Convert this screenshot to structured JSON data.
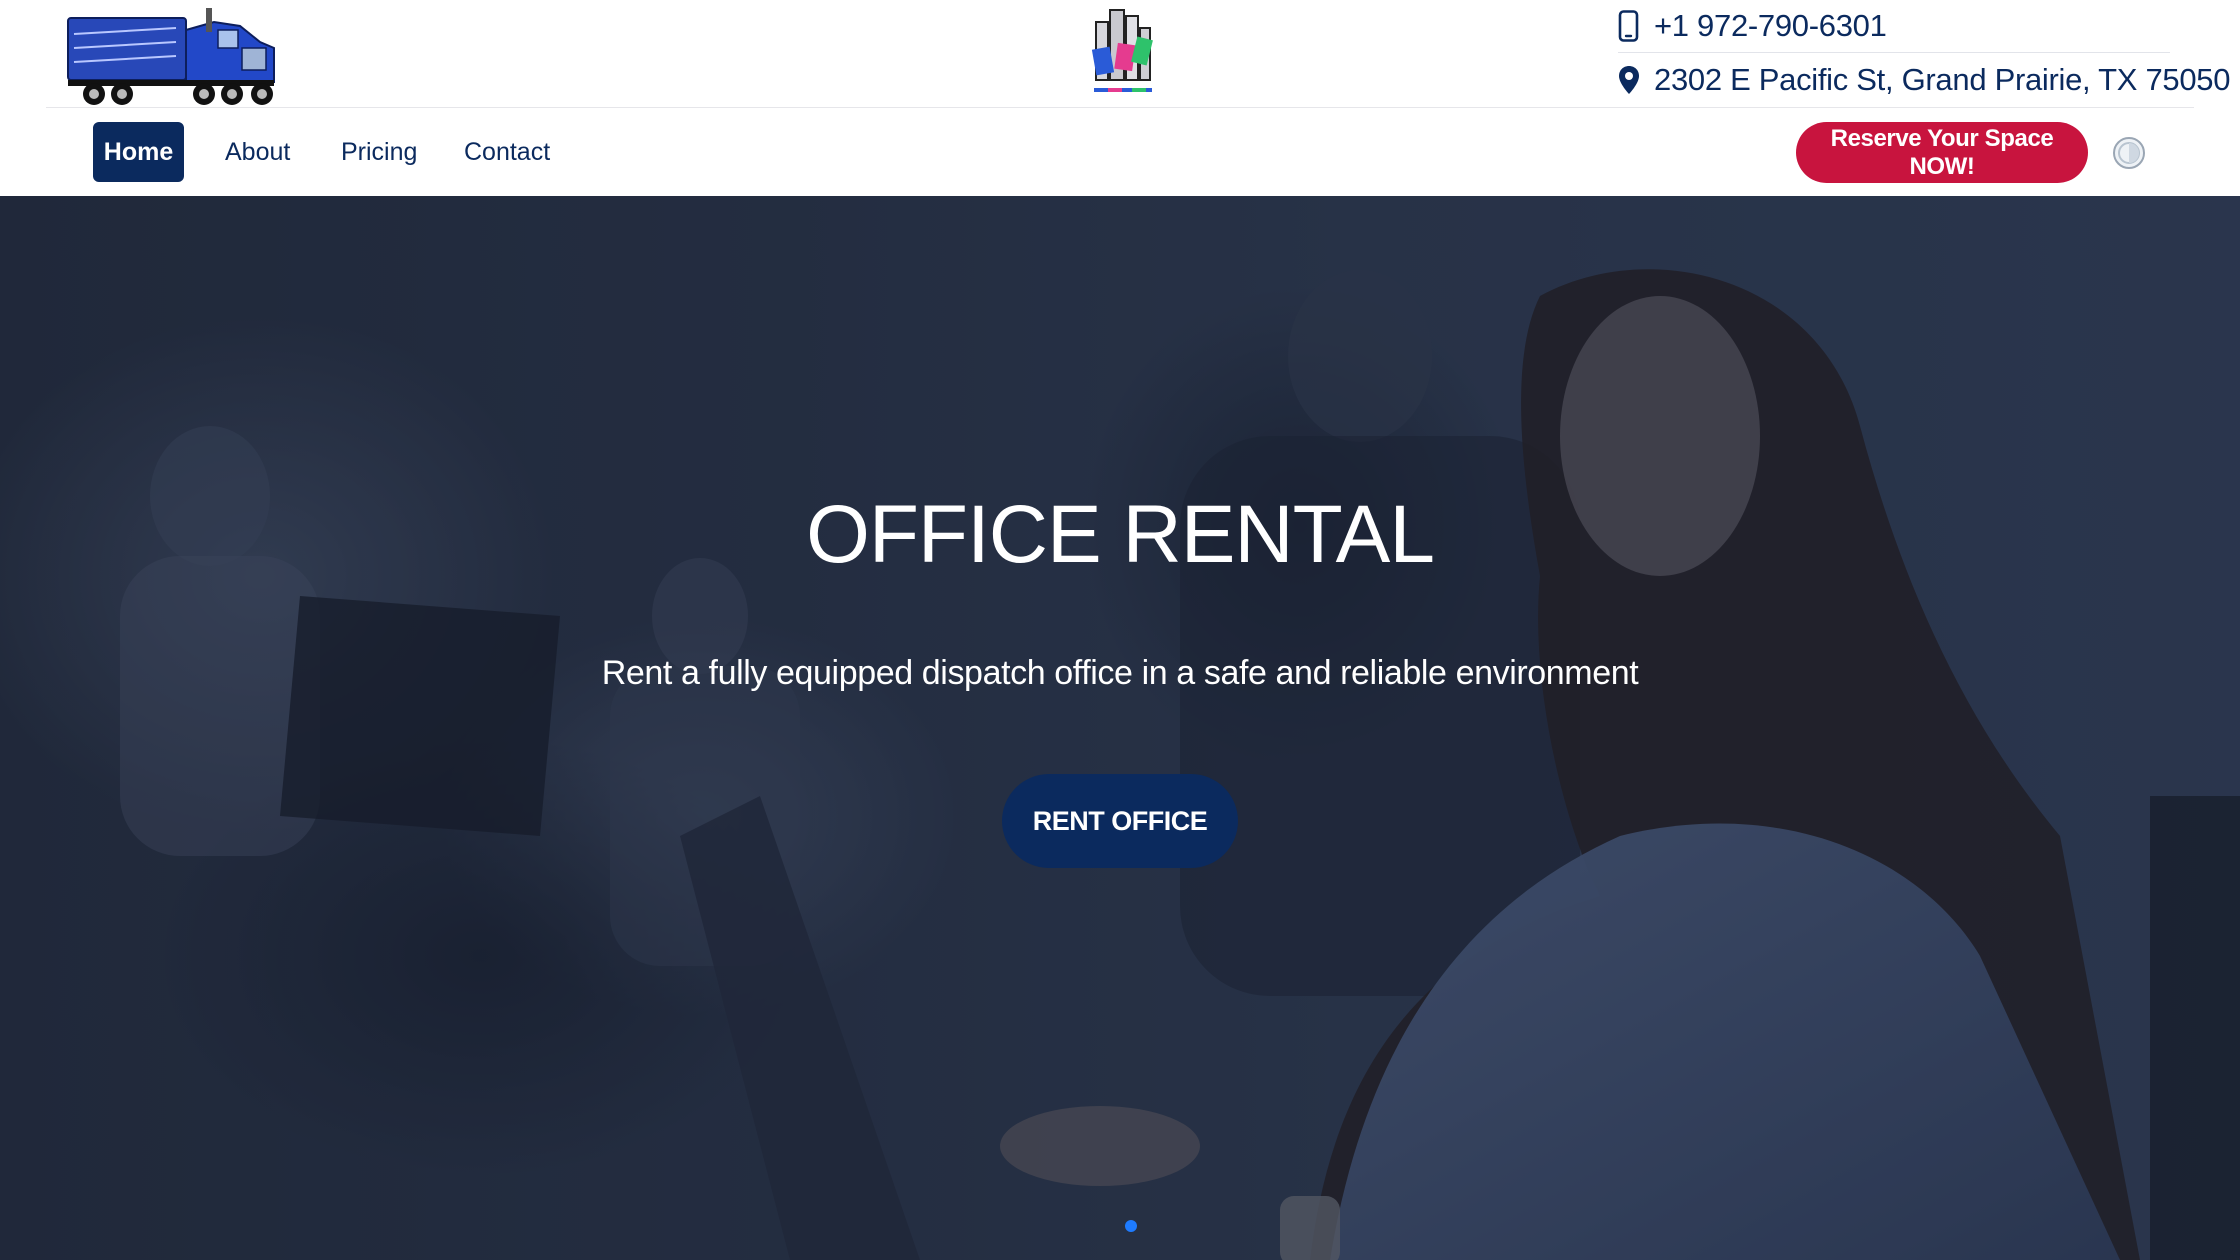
{
  "header": {
    "phone": "+1 972-790-6301",
    "address": "2302 E Pacific St, Grand Prairie, TX 75050",
    "icons": {
      "phone": "mobile-phone-icon",
      "address": "map-pin-icon"
    },
    "logos": {
      "left": "truck-logo",
      "center": "prime-central-realty-logo"
    }
  },
  "nav": {
    "items": [
      {
        "label": "Home",
        "active": true
      },
      {
        "label": "About",
        "active": false
      },
      {
        "label": "Pricing",
        "active": false
      },
      {
        "label": "Contact",
        "active": false
      }
    ],
    "cta_label": "Reserve Your Space NOW!",
    "toggle_icon": "theme-toggle-icon"
  },
  "hero": {
    "title": "OFFICE RENTAL",
    "subtitle": "Rent a fully equipped dispatch office in a safe and reliable environment",
    "button_label": "RENT OFFICE",
    "slides_visible": 1
  },
  "colors": {
    "brand_navy": "#0b2a5e",
    "cta_red": "#c8143e",
    "dot_blue": "#1e7bff"
  }
}
